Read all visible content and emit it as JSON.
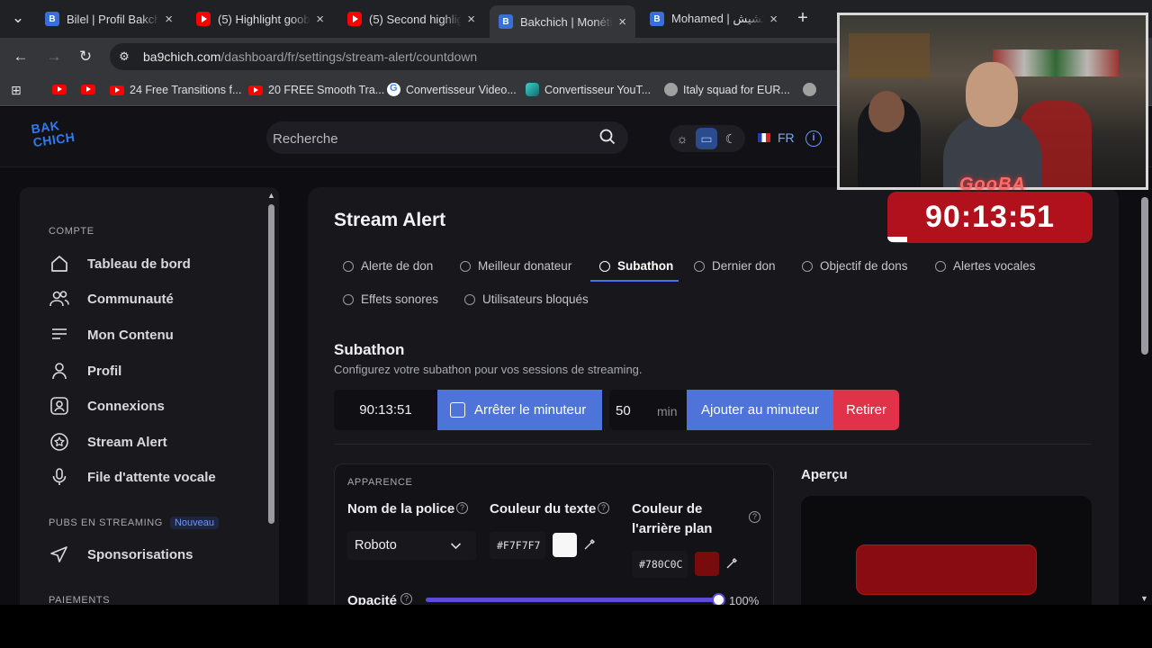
{
  "browser": {
    "tabs": [
      {
        "title": "Bilel | Profil Bakchich",
        "icon": "bakchich-favicon"
      },
      {
        "title": "(5) Highlight goob",
        "icon": "youtube-favicon"
      },
      {
        "title": "(5) Second highlig",
        "icon": "youtube-favicon"
      },
      {
        "title": "Bakchich | Monétis",
        "icon": "bakchich-favicon",
        "active": true
      },
      {
        "title": "Mohamed | كشيش",
        "icon": "bakchich-favicon"
      }
    ],
    "url_host": "ba9chich.com",
    "url_path": "/dashboard/fr/settings/stream-alert/countdown",
    "bookmarks": [
      "",
      "",
      "24 Free Transitions f...",
      "20 FREE Smooth Tra...",
      "Convertisseur Video...",
      "Convertisseur YouT...",
      "Italy squad for EUR..."
    ]
  },
  "header": {
    "logo_line1": "BAK",
    "logo_line2": "CHICH",
    "search_placeholder": "Recherche",
    "lang": "FR"
  },
  "sidebar": {
    "section_compte": "COMPTE",
    "items": [
      {
        "label": "Tableau de bord",
        "icon": "home-icon"
      },
      {
        "label": "Communauté",
        "icon": "users-icon"
      },
      {
        "label": "Mon Contenu",
        "icon": "list-icon"
      },
      {
        "label": "Profil",
        "icon": "user-icon"
      },
      {
        "label": "Connexions",
        "icon": "connection-icon"
      },
      {
        "label": "Stream Alert",
        "icon": "star-badge-icon"
      },
      {
        "label": "File d'attente vocale",
        "icon": "microphone-icon"
      }
    ],
    "section_pubs": "PUBS EN STREAMING",
    "badge_new": "Nouveau",
    "sponsor_label": "Sponsorisations",
    "section_paiements": "PAIEMENTS"
  },
  "main": {
    "title": "Stream Alert",
    "tabs": [
      {
        "label": "Alerte de don"
      },
      {
        "label": "Meilleur donateur"
      },
      {
        "label": "Subathon",
        "active": true
      },
      {
        "label": "Dernier don"
      },
      {
        "label": "Objectif de dons"
      },
      {
        "label": "Alertes vocales"
      },
      {
        "label": "Effets sonores"
      },
      {
        "label": "Utilisateurs bloqués"
      }
    ],
    "subathon_title": "Subathon",
    "subathon_desc": "Configurez votre subathon pour vos sessions de streaming.",
    "timer_value": "90:13:51",
    "stop_label": "Arrêter le minuteur",
    "minutes_value": "50",
    "minutes_unit": "min",
    "add_label": "Ajouter au minuteur",
    "remove_label": "Retirer",
    "appearance_label": "APPARENCE",
    "font_label": "Nom de la police",
    "font_value": "Roboto",
    "text_color_label": "Couleur du texte",
    "text_color_hex": "#F7F7F7",
    "bg_color_label_1": "Couleur de",
    "bg_color_label_2": "l'arrière plan",
    "bg_color_hex": "#780C0C",
    "opacity_label": "Opacité",
    "opacity_value": "100%",
    "opacity_fraction": 1.0,
    "preview_label": "Aperçu"
  },
  "overlay": {
    "streamer_name": "GooBA",
    "timer": "90:13:51"
  },
  "colors": {
    "accent_blue": "#4f74d9",
    "danger_red": "#e0334a",
    "text_swatch": "#F7F7F7",
    "bg_swatch": "#780C0C",
    "slider": "#5a4bdb"
  }
}
